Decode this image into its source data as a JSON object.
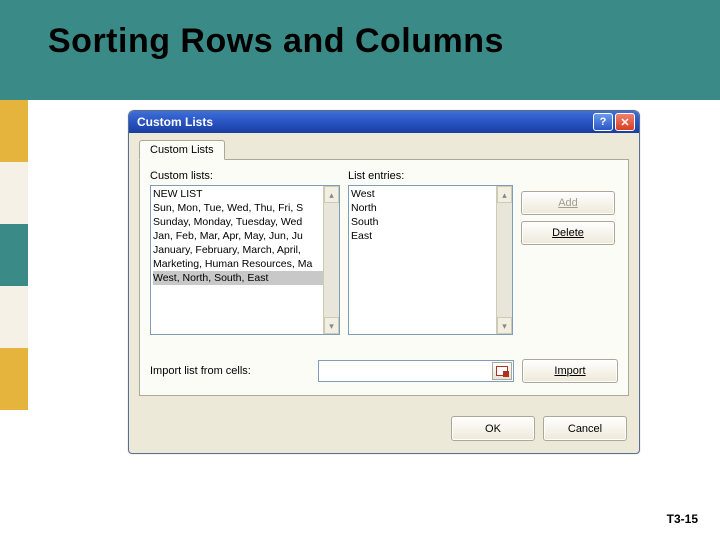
{
  "slide": {
    "title": "Sorting Rows and Columns",
    "number": "T3-15"
  },
  "dialog": {
    "title": "Custom Lists",
    "tab": "Custom Lists",
    "labels": {
      "custom_lists": "Custom lists:",
      "list_entries": "List entries:",
      "import_label": "Import list from cells:"
    },
    "custom_list_items": [
      "NEW LIST",
      "Sun, Mon, Tue, Wed, Thu, Fri, S",
      "Sunday, Monday, Tuesday, Wed",
      "Jan, Feb, Mar, Apr, May, Jun, Ju",
      "January, February, March, April,",
      "Marketing, Human Resources, Ma",
      "West, North, South, East"
    ],
    "selected_index": 6,
    "entries": [
      "West",
      "North",
      "South",
      "East"
    ],
    "buttons": {
      "add": "Add",
      "delete": "Delete",
      "import": "Import",
      "ok": "OK",
      "cancel": "Cancel"
    }
  }
}
